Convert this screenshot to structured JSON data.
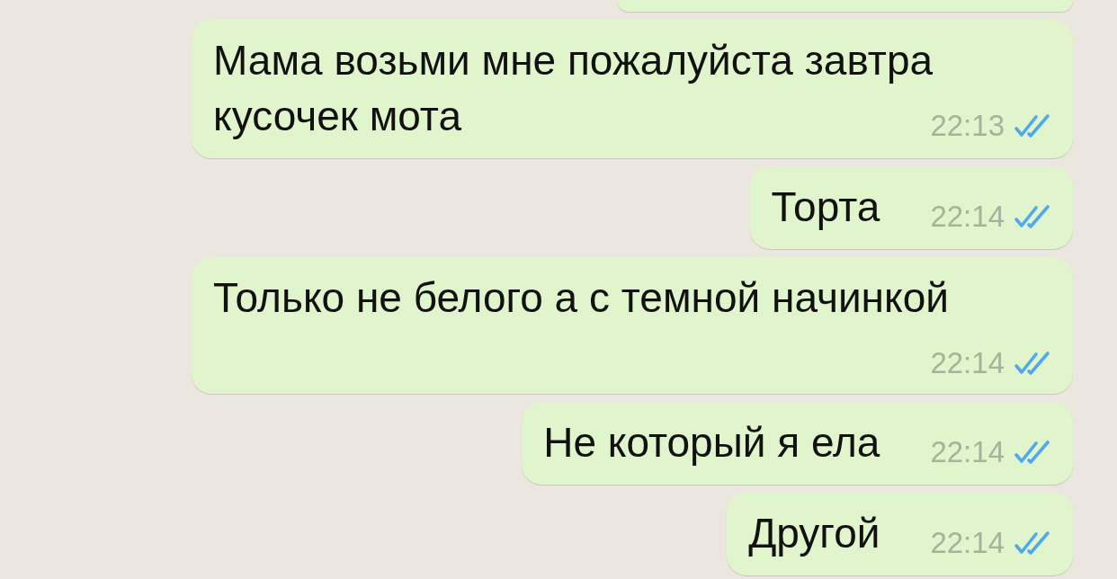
{
  "messages": [
    {
      "kind": "clipped"
    },
    {
      "kind": "text",
      "text": "Мама возьми мне пожалуйста завтра кусочек мота",
      "time": "22:13",
      "read": true
    },
    {
      "kind": "text",
      "text": "Торта",
      "time": "22:14",
      "read": true
    },
    {
      "kind": "text",
      "text": "Только не белого а с темной начинкой",
      "time": "22:14",
      "read": true
    },
    {
      "kind": "text",
      "text": "Не который я ела",
      "time": "22:14",
      "read": true
    },
    {
      "kind": "text",
      "text": "Другой",
      "time": "22:14",
      "read": true
    }
  ]
}
